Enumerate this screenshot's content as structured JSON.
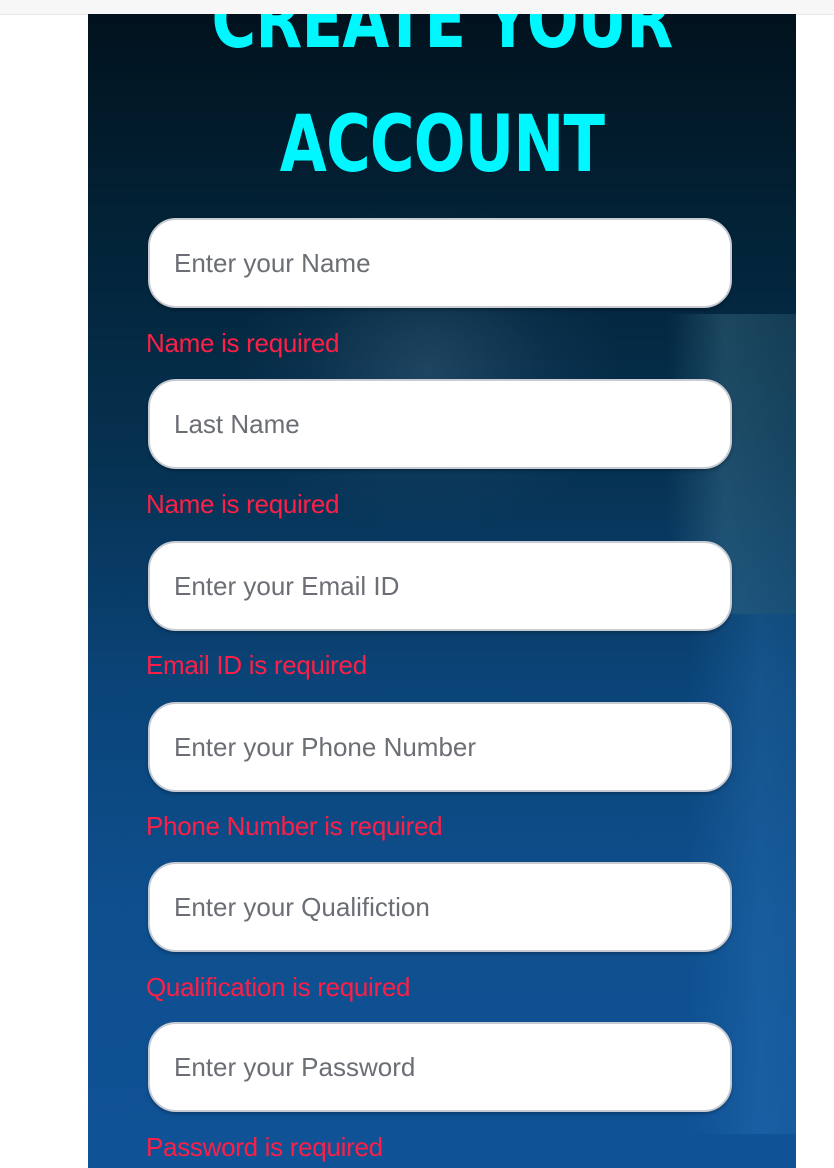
{
  "form": {
    "title_line1": "CREATE YOUR",
    "title_line2": "ACCOUNT",
    "fields": [
      {
        "placeholder": "Enter your Name",
        "value": "",
        "error": "Name is required"
      },
      {
        "placeholder": "Last Name",
        "value": "",
        "error": "Name is required"
      },
      {
        "placeholder": "Enter your Email ID",
        "value": "",
        "error": "Email ID is required"
      },
      {
        "placeholder": "Enter your Phone Number",
        "value": "",
        "error": "Phone Number is required"
      },
      {
        "placeholder": "Enter your Qualifiction",
        "value": "",
        "error": "Qualification is required"
      },
      {
        "placeholder": "Enter your Password",
        "value": "",
        "error": "Password is required"
      }
    ]
  },
  "colors": {
    "title": "#00f7ff",
    "error": "#ff1f46",
    "panel_top": "#01121d",
    "panel_bottom": "#0f5296"
  }
}
